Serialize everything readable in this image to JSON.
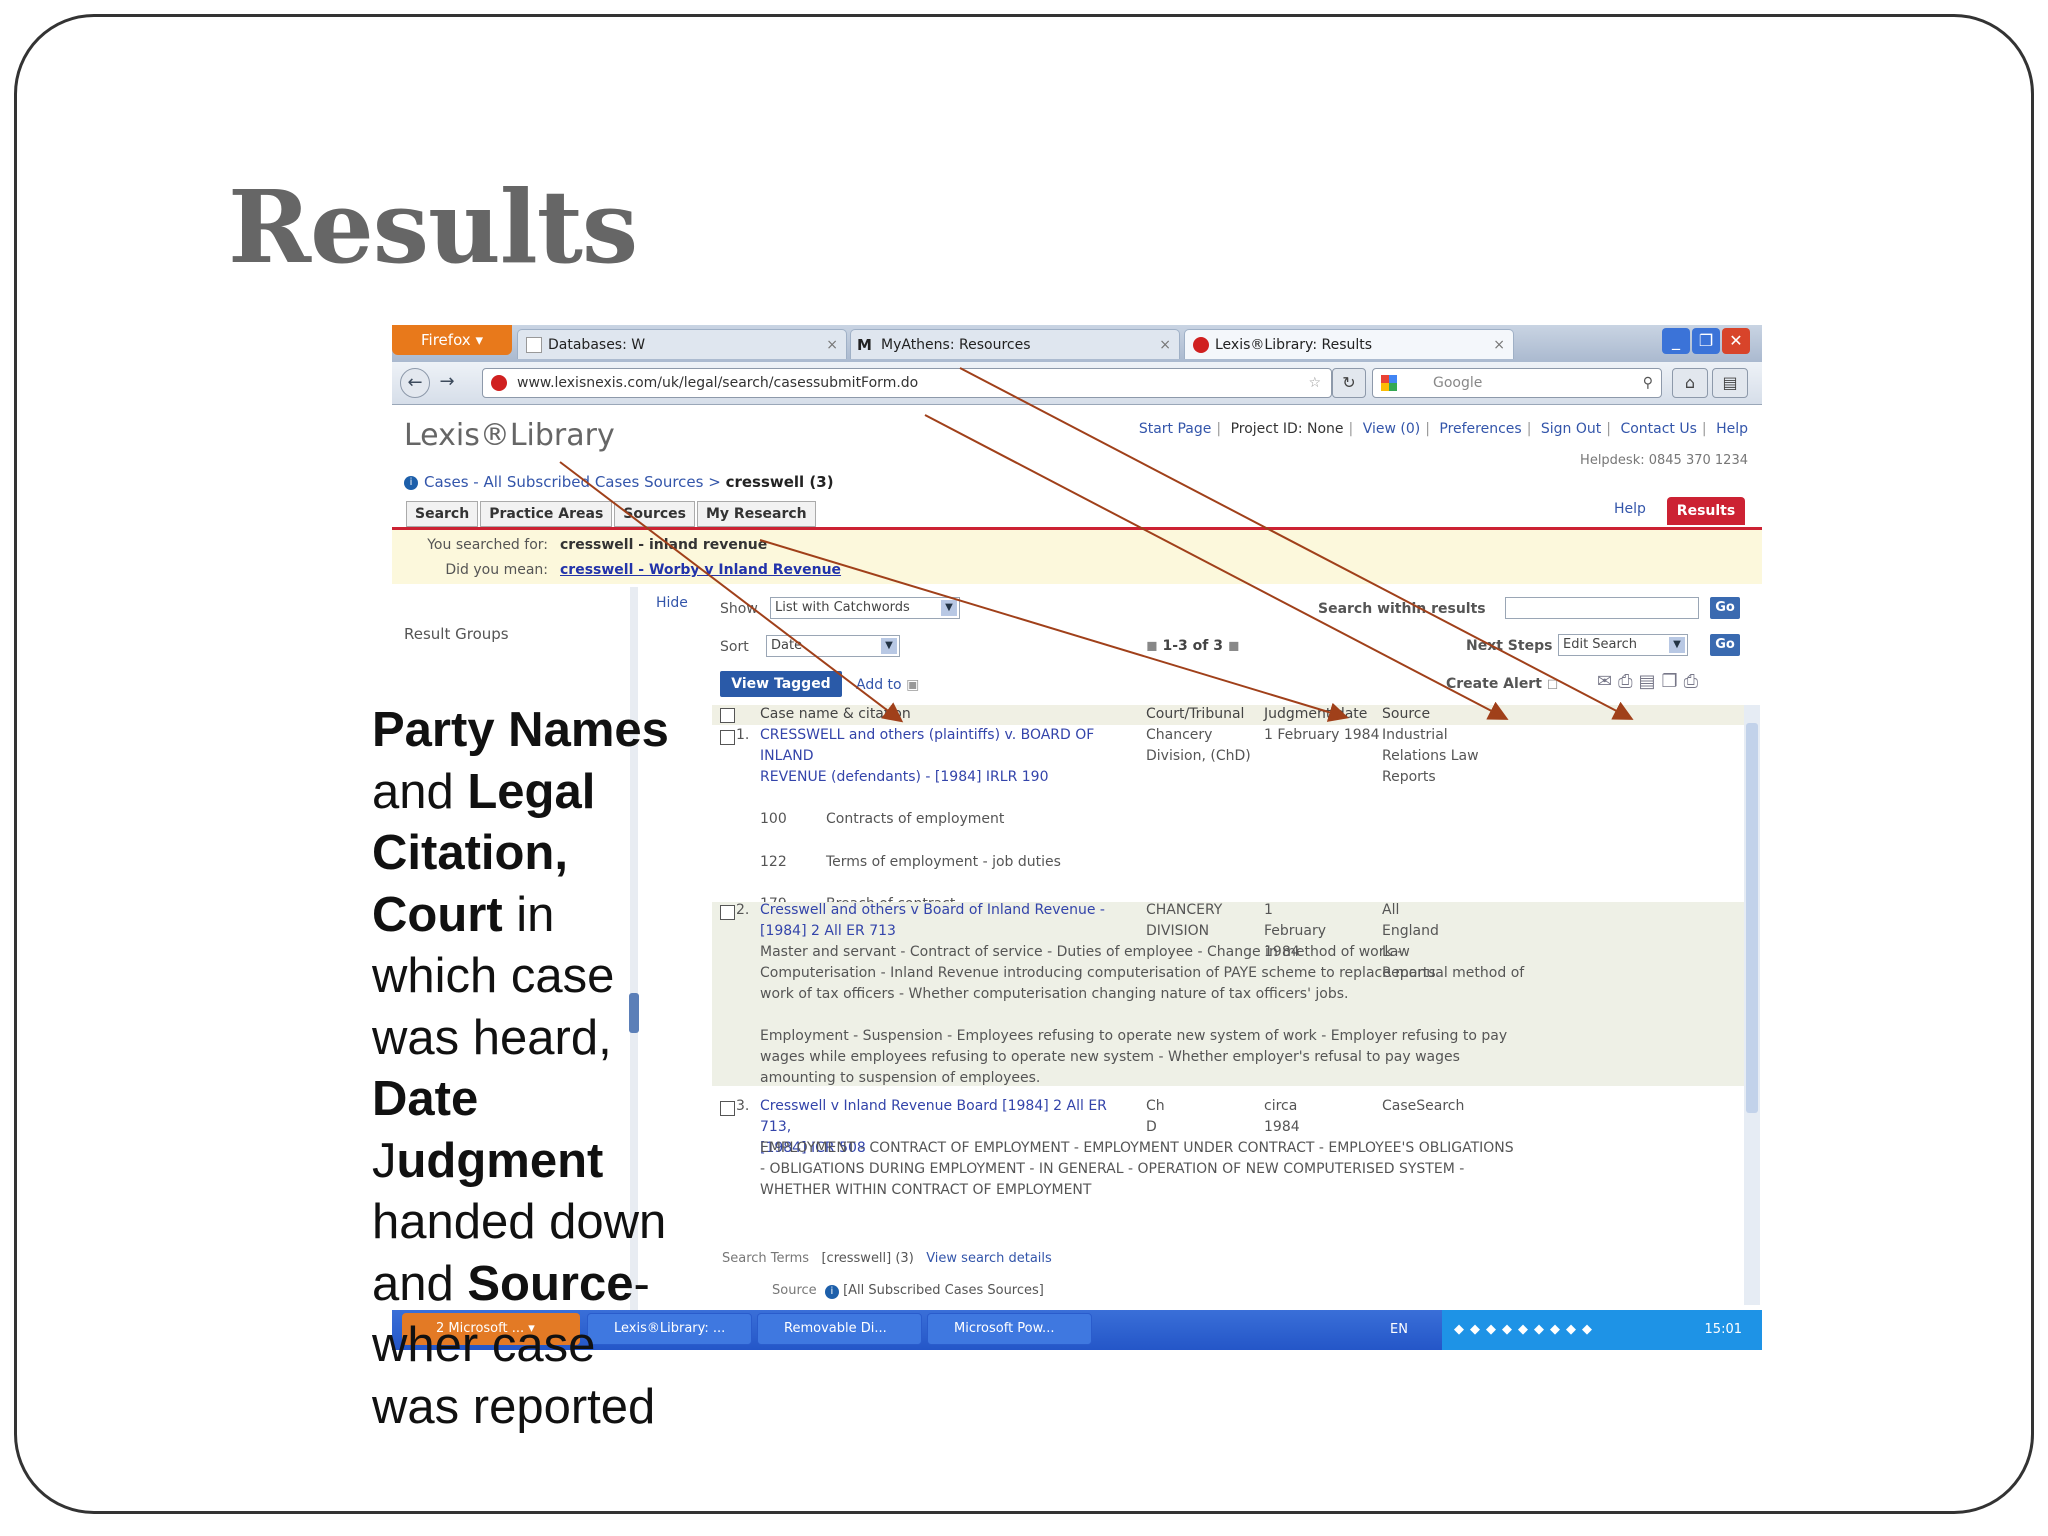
{
  "slide": {
    "title": "Results",
    "caption": [
      {
        "text": "Party Names",
        "bold": true
      },
      {
        "text": " and ",
        "bold": false
      },
      {
        "text": "Legal Citation, Court",
        "bold": true
      },
      {
        "text": " in which case was heard, ",
        "bold": false
      },
      {
        "text": "Date",
        "bold": true
      },
      {
        "text": " J",
        "bold": false
      },
      {
        "text": "udgment",
        "bold": true
      },
      {
        "text": " handed down and ",
        "bold": false
      },
      {
        "text": "Source",
        "bold": true
      },
      {
        "text": "- wher case was reported",
        "bold": false
      }
    ]
  },
  "browser": {
    "firefox_button": "Firefox",
    "tabs": [
      "Databases: W",
      "MyAthens: Resources",
      "Lexis®Library: Results"
    ],
    "url": "www.lexisnexis.com/uk/legal/search/casessubmitForm.do",
    "search_engine": "Google"
  },
  "site": {
    "logo": "Lexis®Library",
    "top_links": [
      "Start Page",
      "Project ID: None",
      "View (0)",
      "Preferences",
      "Sign Out",
      "Contact Us",
      "Help"
    ],
    "helpdesk": "Helpdesk: 0845 370 1234",
    "breadcrumb_link": "Cases - All Subscribed Cases Sources",
    "breadcrumb_current": "cresswell (3)",
    "nav_tabs": [
      "Search",
      "Practice Areas",
      "Sources",
      "My Research"
    ],
    "help": "Help",
    "results_tab": "Results",
    "you_searched_label": "You searched for:",
    "you_searched_value": "cresswell - inland revenue",
    "did_you_mean_label": "Did you mean:",
    "did_you_mean_value": "cresswell - Worby v Inland Revenue"
  },
  "sidebar": {
    "hide": "Hide",
    "result_groups": "Result Groups"
  },
  "controls": {
    "show_label": "Show",
    "show_value": "List with Catchwords",
    "sort_label": "Sort",
    "sort_value": "Date",
    "pager": "1-3 of 3",
    "search_within_label": "Search within results",
    "next_steps_label": "Next Steps",
    "next_steps_value": "Edit Search",
    "go": "Go",
    "view_tagged": "View Tagged",
    "add_to": "Add to",
    "create_alert": "Create Alert"
  },
  "table": {
    "headers": [
      "Case name & citation",
      "Court/Tribunal",
      "Judgment date",
      "Source"
    ],
    "rows": [
      {
        "num": "1.",
        "title_lines": [
          "CRESSWELL and others (plaintiffs) v. BOARD OF INLAND",
          "REVENUE (defendants) - [1984] IRLR 190"
        ],
        "court_lines": [
          "Chancery",
          "Division, (ChD)"
        ],
        "date": "1 February 1984",
        "source_lines": [
          "Industrial",
          "Relations Law",
          "Reports"
        ],
        "catchwords": [
          {
            "code": "100",
            "text": "Contracts of employment"
          },
          {
            "code": "122",
            "text": "Terms of employment - job duties"
          },
          {
            "code": "179",
            "text": "Breach of contract"
          }
        ]
      },
      {
        "num": "2.",
        "title_lines": [
          "Cresswell and others v Board of Inland Revenue -",
          "[1984] 2 All ER 713"
        ],
        "court_lines": [
          "CHANCERY",
          "DIVISION"
        ],
        "date": "1 February 1984",
        "source_lines": [
          "All England Law",
          "Reports"
        ],
        "summary_lines": [
          "Master and servant - Contract of service - Duties of employee - Change in method of work -",
          "Computerisation - Inland Revenue introducing computerisation of PAYE scheme to replace manual method of",
          "work of tax officers - Whether computerisation changing nature of tax officers' jobs.",
          "",
          "Employment - Suspension - Employees refusing to operate new system of work - Employer refusing to pay",
          "wages while employees refusing to operate new system - Whether employer's refusal to pay wages",
          "amounting to suspension of employees."
        ]
      },
      {
        "num": "3.",
        "title_lines": [
          "Cresswell v Inland Revenue Board [1984] 2 All ER 713,",
          "[1984] ICR 508"
        ],
        "court_lines": [
          "Ch D"
        ],
        "date": "circa 1984",
        "source_lines": [
          "CaseSearch"
        ],
        "summary_lines": [
          "EMPLOYMENT - CONTRACT OF EMPLOYMENT - EMPLOYMENT UNDER CONTRACT - EMPLOYEE'S OBLIGATIONS",
          "- OBLIGATIONS DURING EMPLOYMENT - IN GENERAL - OPERATION OF NEW COMPUTERISED SYSTEM -",
          "WHETHER WITHIN CONTRACT OF EMPLOYMENT"
        ]
      }
    ]
  },
  "footer": {
    "search_terms_label": "Search Terms",
    "search_terms_value": "[cresswell] (3)",
    "view_details": "View search details",
    "source_label": "Source",
    "source_value": "[All Subscribed Cases Sources]"
  },
  "taskbar": {
    "start": "2 Microsoft ...",
    "items": [
      "Lexis®Library: ...",
      "Removable Di...",
      "Microsoft Pow..."
    ],
    "lang": "EN",
    "clock": "15:01"
  },
  "colors": {
    "arrow": "#a0401a",
    "results_tab": "#cc2233",
    "link": "#3344aa"
  }
}
